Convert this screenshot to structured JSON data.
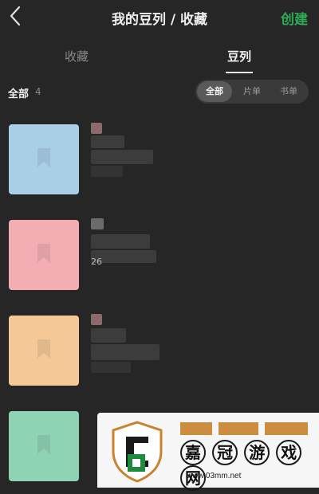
{
  "header": {
    "title": "我的豆列 / 收藏",
    "create_label": "创建"
  },
  "tabs": [
    {
      "label": "收藏",
      "active": false
    },
    {
      "label": "豆列",
      "active": true
    }
  ],
  "filter": {
    "all_label": "全部",
    "all_count": "4",
    "segments": [
      {
        "label": "全部",
        "selected": true
      },
      {
        "label": "片单",
        "selected": false
      },
      {
        "label": "书单",
        "selected": false
      }
    ]
  },
  "items": [
    {
      "cover_color": "#a9cfe6",
      "subtitle": ""
    },
    {
      "cover_color": "#f2aeb3",
      "subtitle": "26"
    },
    {
      "cover_color": "#f4c997",
      "subtitle": ""
    },
    {
      "cover_color": "#8fd3b5",
      "subtitle": ""
    }
  ],
  "watermark": {
    "chars": [
      "嘉",
      "冠",
      "游",
      "戏",
      "网"
    ],
    "url": "www.03mm.net"
  },
  "colors": {
    "accent": "#2faa54",
    "background": "#262626"
  }
}
